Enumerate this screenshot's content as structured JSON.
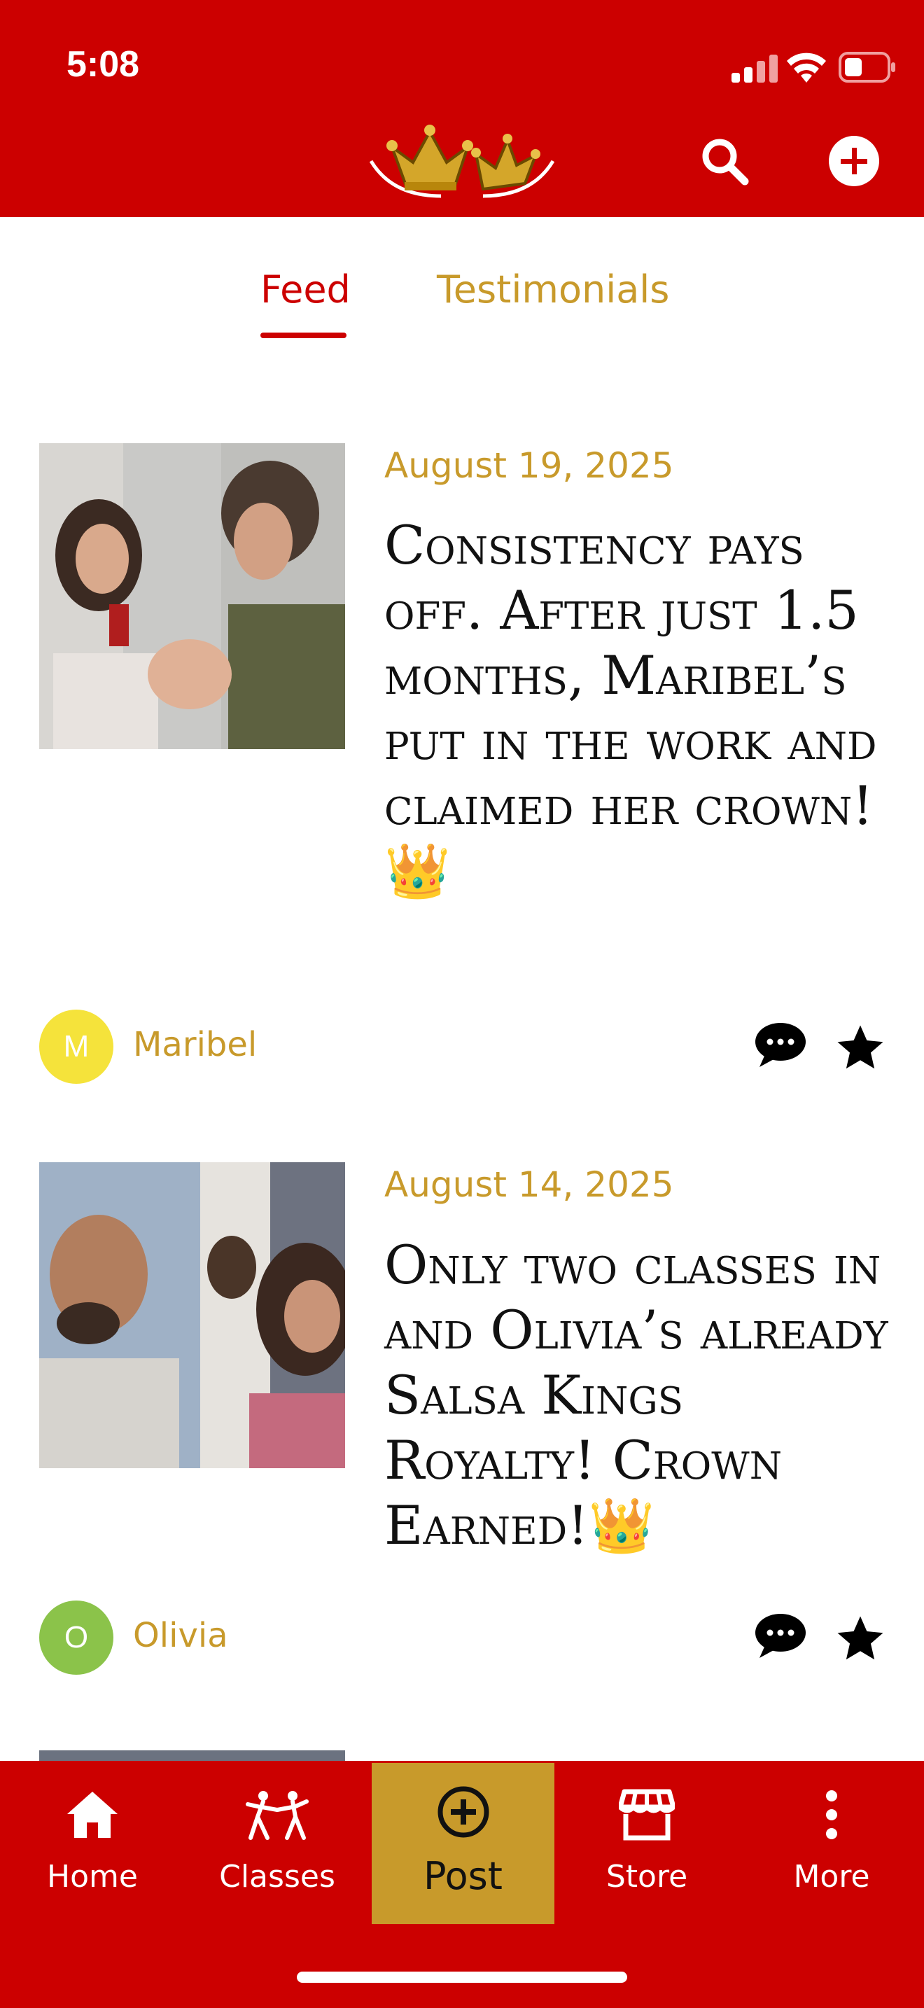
{
  "status_bar": {
    "time": "5:08"
  },
  "header": {
    "brand_color": "#cc0000",
    "accent_color": "#c89a2b",
    "search_icon": "search-icon",
    "add_icon": "plus-circle-icon"
  },
  "tabs": [
    {
      "label": "Feed",
      "active": true
    },
    {
      "label": "Testimonials",
      "active": false
    }
  ],
  "posts": [
    {
      "date": "August 19, 2025",
      "title": "Consistency pays off. After just 1.5 months, Maribel’s put in the work and claimed her crown! 👑",
      "author": "Maribel",
      "avatar_letter": "M",
      "avatar_color": "#f5e33b"
    },
    {
      "date": "August 14, 2025",
      "title": "Only two classes in and Olivia’s already Salsa Kings Royalty! Crown Earned!👑",
      "author": "Olivia",
      "avatar_letter": "O",
      "avatar_color": "#8bc34a"
    }
  ],
  "nav": [
    {
      "label": "Home",
      "icon": "home-icon"
    },
    {
      "label": "Classes",
      "icon": "dancers-icon"
    },
    {
      "label": "Post",
      "icon": "plus-circle-icon",
      "active": true
    },
    {
      "label": "Store",
      "icon": "store-icon"
    },
    {
      "label": "More",
      "icon": "more-vertical-icon"
    }
  ]
}
